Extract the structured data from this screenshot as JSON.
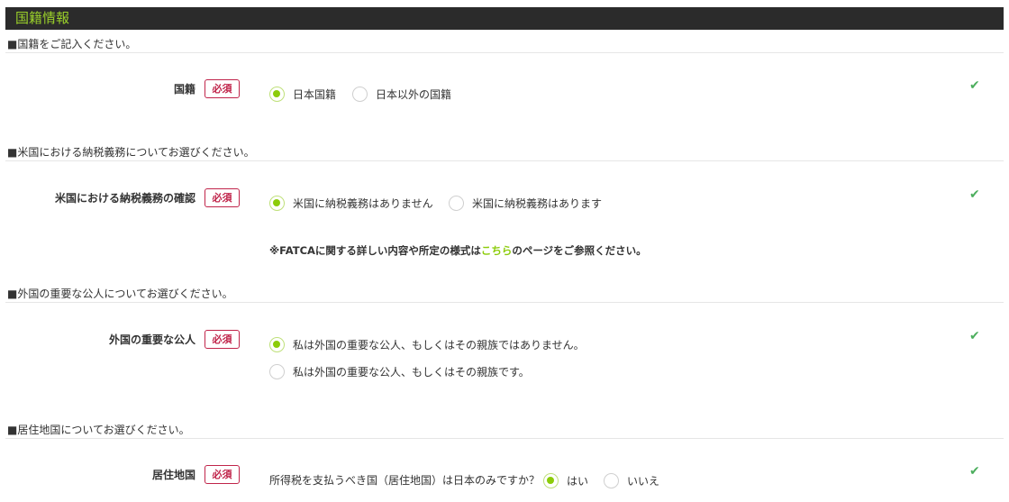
{
  "header": {
    "title": "国籍情報"
  },
  "sections": [
    {
      "note": "■国籍をご記入ください。",
      "label": "国籍",
      "required": "必須",
      "options": [
        "日本国籍",
        "日本以外の国籍"
      ],
      "selected": 0
    },
    {
      "note": "■米国における納税義務についてお選びください。",
      "label": "米国における納税義務の確認",
      "required": "必須",
      "options": [
        "米国に納税義務はありません",
        "米国に納税義務はあります"
      ],
      "selected": 0,
      "fatca": {
        "prefix": "※FATCAに関する詳しい内容や所定の様式は",
        "link": "こちら",
        "suffix": "のページをご参照ください。"
      }
    },
    {
      "note": "■外国の重要な公人についてお選びください。",
      "label": "外国の重要な公人",
      "required": "必須",
      "options": [
        "私は外国の重要な公人、もしくはその親族ではありません。",
        "私は外国の重要な公人、もしくはその親族です。"
      ],
      "selected": 0
    },
    {
      "note": "■居住地国についてお選びください。",
      "label": "居住地国",
      "required": "必須",
      "question": "所得税を支払うべき国（居住地国）は日本のみですか？",
      "options": [
        "はい",
        "いいえ"
      ],
      "selected": 0
    }
  ],
  "check_glyph": "✔",
  "colors": {
    "accent": "#8ccc0a",
    "required": "#c0244a",
    "check": "#4cae5d",
    "header_bg": "#2b2b2b"
  }
}
